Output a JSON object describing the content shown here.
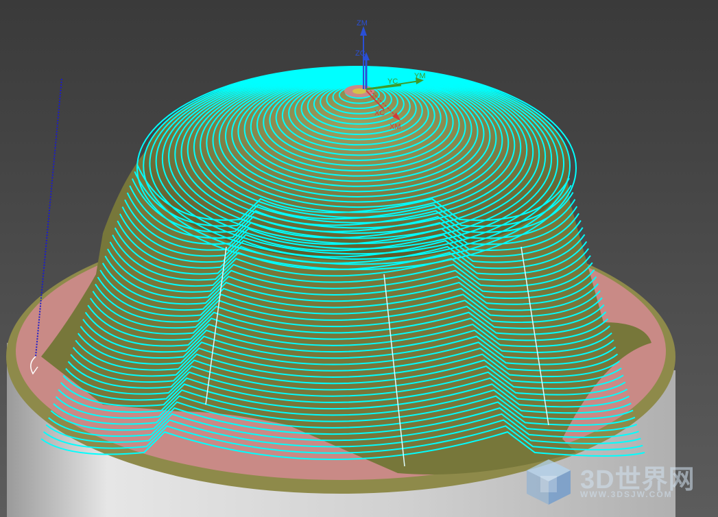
{
  "viewport": {
    "background_top": "#3a3a3a",
    "background_bottom": "#5a5a5a"
  },
  "axes": {
    "zm_label": "ZM",
    "zc_label": "ZC",
    "yc_label": "YC",
    "ym_label": "YM",
    "xc_label": "XC",
    "xm_label": "XM",
    "z_color": "#2a4fd6",
    "y_color": "#3f9a2a",
    "x_color": "#d23a3a"
  },
  "colors": {
    "toolpath": "#00ffff",
    "part_surface": "#8a8a3c",
    "floor": "#c98a86",
    "rim": "#8e8a4a",
    "stock": "#d8d8d8",
    "engage_path": "#1a1acc"
  },
  "watermark": {
    "logo_text": "3D世界网",
    "url": "WWW.3DSJW.COM"
  }
}
